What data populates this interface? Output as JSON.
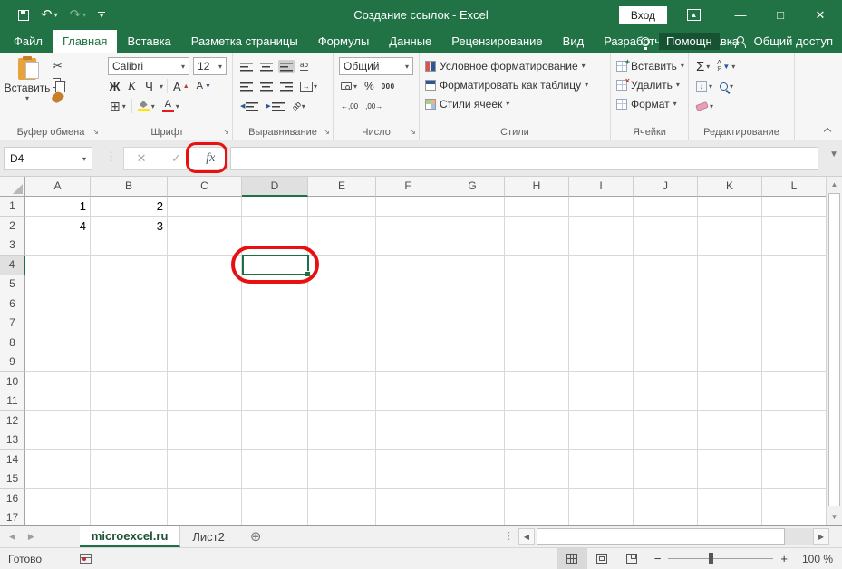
{
  "title_bar": {
    "title": "Создание ссылок  -  Excel",
    "sign_in": "Вход"
  },
  "ribbon_tabs": [
    "Файл",
    "Главная",
    "Вставка",
    "Разметка страницы",
    "Формулы",
    "Данные",
    "Рецензирование",
    "Вид",
    "Разработчик",
    "Справка"
  ],
  "active_tab_index": 1,
  "assistant": {
    "label": "Помощн"
  },
  "share": {
    "label": "Общий доступ"
  },
  "ribbon": {
    "clipboard": {
      "label": "Буфер обмена",
      "paste": "Вставить"
    },
    "font": {
      "label": "Шрифт",
      "font_name": "Calibri",
      "font_size": "12",
      "bold": "Ж",
      "italic": "К",
      "underline": "Ч",
      "grow": "А",
      "shrink": "А",
      "border": "⊞",
      "color_letter": "А"
    },
    "alignment": {
      "label": "Выравнивание",
      "wrap": "ab",
      "orient": "ab",
      "merge_arrow": "↔"
    },
    "number": {
      "label": "Число",
      "format": "Общий",
      "percent": "%",
      "thousands": "000",
      "inc_dec": "←,00",
      "dec_dec": ",00→"
    },
    "styles": {
      "label": "Стили",
      "items": [
        "Условное форматирование",
        "Форматировать как таблицу",
        "Стили ячеек"
      ]
    },
    "cells": {
      "label": "Ячейки",
      "items": [
        "Вставить",
        "Удалить",
        "Формат"
      ]
    },
    "editing": {
      "label": "Редактирование",
      "sum": "Σ",
      "sort_a": "А",
      "sort_z": "Я",
      "fill_arrow": "↓"
    }
  },
  "formula_bar": {
    "name_box": "D4",
    "cancel": "✕",
    "enter": "✓",
    "fx": "fx",
    "formula": ""
  },
  "grid": {
    "columns": [
      "A",
      "B",
      "C",
      "D",
      "E",
      "F",
      "G",
      "H",
      "I",
      "J",
      "K",
      "L"
    ],
    "rows": 18,
    "cells": {
      "A1": "1",
      "B1": "2",
      "A2": "4",
      "B2": "3"
    },
    "selected_cell": "D4",
    "selected_column": "D",
    "selected_row": 4
  },
  "sheet_bar": {
    "tabs": [
      {
        "name": "microexcel.ru",
        "active": true
      },
      {
        "name": "Лист2",
        "active": false
      }
    ],
    "add": "⊕"
  },
  "status_bar": {
    "ready": "Готово",
    "zoom": "100 %"
  },
  "colors": {
    "excel_green": "#217346",
    "selection_green": "#1e7145",
    "annotation_red": "#e81111",
    "fill_yellow": "#ffe800",
    "font_red": "#e02020"
  }
}
